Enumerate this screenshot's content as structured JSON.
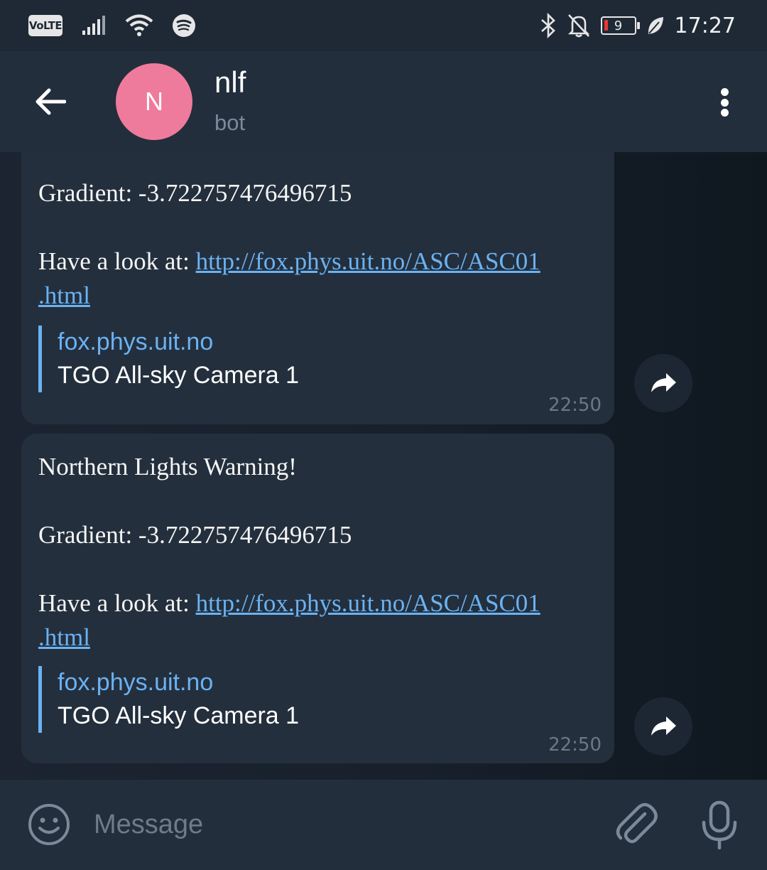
{
  "status_bar": {
    "volte_label": "VoLTE",
    "battery_level": "9",
    "time": "17:27",
    "icons": [
      "signal-icon",
      "wifi-icon",
      "spotify-icon",
      "bluetooth-icon",
      "mute-icon",
      "battery-icon",
      "leaf-icon"
    ]
  },
  "header": {
    "avatar_letter": "N",
    "title": "nlf",
    "subtitle": "bot",
    "avatar_color": "#ef7b9c"
  },
  "messages": [
    {
      "header_text": "",
      "gradient": "Gradient: -3.722757476496715",
      "look_prefix": "Have a look at: ",
      "link_line1": "http://fox.phys.uit.no/ASC/ASC01",
      "link_line2": ".html",
      "preview_site": "fox.phys.uit.no",
      "preview_title": "TGO All-sky Camera 1",
      "time": "22:50"
    },
    {
      "header_text": "Northern Lights Warning!",
      "gradient": "Gradient: -3.722757476496715",
      "look_prefix": "Have a look at: ",
      "link_line1": "http://fox.phys.uit.no/ASC/ASC01",
      "link_line2": ".html",
      "preview_site": "fox.phys.uit.no",
      "preview_title": "TGO All-sky Camera 1",
      "time": "22:50"
    }
  ],
  "input": {
    "placeholder": "Message"
  },
  "colors": {
    "link": "#6ab2f2",
    "bubble": "#242f3d",
    "header": "#232e3c"
  }
}
